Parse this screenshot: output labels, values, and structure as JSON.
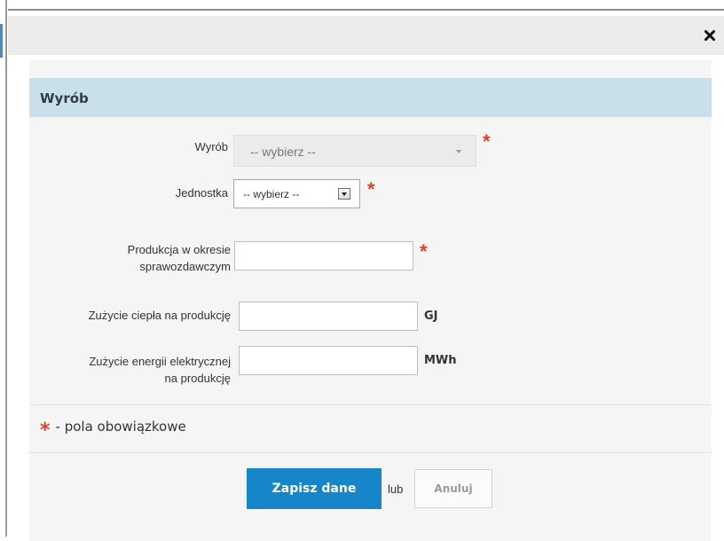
{
  "dialog": {
    "close_icon": "close-icon",
    "section_title": "Wyrób"
  },
  "form": {
    "product": {
      "label": "Wyrób",
      "value": "-- wybierz --",
      "required": true
    },
    "unit": {
      "label": "Jednostka",
      "value": "-- wybierz --",
      "required": true
    },
    "production": {
      "label_line1": "Produkcja w okresie",
      "label_line2": "sprawozdawczym",
      "value": "",
      "required": true
    },
    "heat": {
      "label": "Zużycie ciepła na produkcję",
      "value": "",
      "unit": "GJ"
    },
    "energy": {
      "label_line1": "Zużycie energii elektrycznej",
      "label_line2": "na produkcję",
      "value": "",
      "unit": "MWh"
    }
  },
  "legend": {
    "star": "*",
    "text": "- pola obowiązkowe"
  },
  "actions": {
    "save_label": "Zapisz dane",
    "or_label": "lub",
    "cancel_label": "Anuluj"
  },
  "colors": {
    "accent": "#1686c8",
    "required": "#d9432c",
    "header_bg": "#c9e0ea"
  }
}
